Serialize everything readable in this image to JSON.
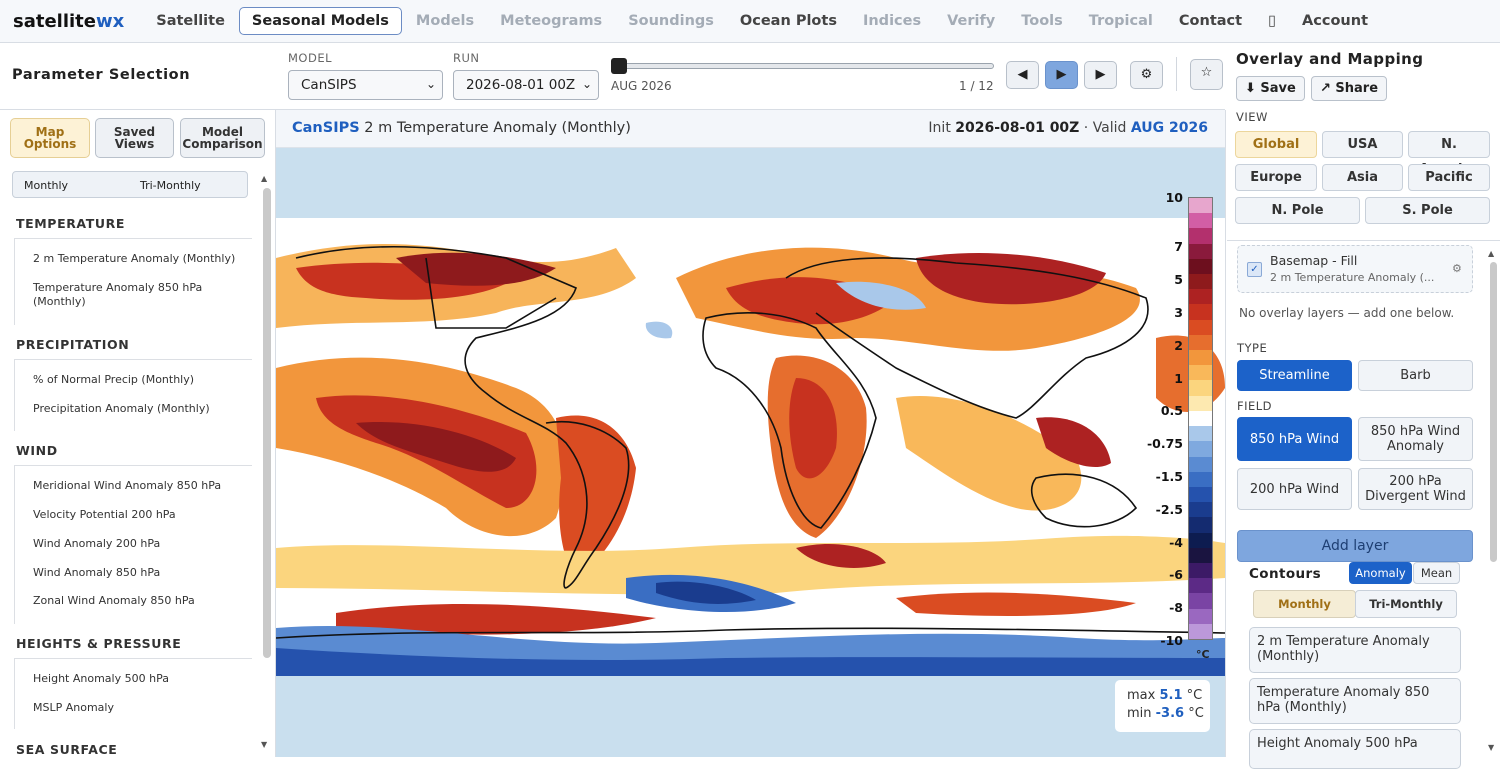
{
  "nav": {
    "brand_main": "satellite",
    "brand_accent": "wx",
    "items": [
      "Satellite",
      "Seasonal Models",
      "Models",
      "Meteograms",
      "Soundings",
      "Ocean Plots",
      "Indices",
      "Verify",
      "Tools",
      "Tropical",
      "Contact",
      "Account"
    ],
    "active": "Seasonal Models",
    "icon_glyph": "▯"
  },
  "toolbar": {
    "panel_title": "Parameter Selection",
    "model_label": "MODEL",
    "model_value": "CanSIPS",
    "run_label": "RUN",
    "run_value": "2026-08-01 00Z",
    "frame_label": "AUG 2026",
    "frame_counter": "1 / 12",
    "prev_glyph": "◀",
    "play_glyph": "▶",
    "next_glyph": "▶",
    "settings_glyph": "⚙",
    "star_glyph": "☆"
  },
  "left": {
    "tabs": [
      "Map Options",
      "Saved Views",
      "Model Comparison"
    ],
    "tab_lines": [
      [
        "Map",
        "Options"
      ],
      [
        "Saved",
        "Views"
      ],
      [
        "Model",
        "Comparison"
      ]
    ],
    "period_options": [
      "Monthly",
      "Tri-Monthly"
    ],
    "categories": [
      {
        "name": "TEMPERATURE",
        "items": [
          "2 m Temperature Anomaly (Monthly)",
          "Temperature Anomaly 850 hPa (Monthly)"
        ]
      },
      {
        "name": "PRECIPITATION",
        "items": [
          "% of Normal Precip (Monthly)",
          "Precipitation Anomaly (Monthly)"
        ]
      },
      {
        "name": "WIND",
        "items": [
          "Meridional Wind Anomaly 850 hPa",
          "Velocity Potential 200 hPa",
          "Wind Anomaly 200 hPa",
          "Wind Anomaly 850 hPa",
          "Zonal Wind Anomaly 850 hPa"
        ]
      },
      {
        "name": "HEIGHTS & PRESSURE",
        "items": [
          "Height Anomaly 500 hPa",
          "MSLP Anomaly"
        ]
      },
      {
        "name": "SEA SURFACE",
        "items": []
      }
    ]
  },
  "map": {
    "model": "CanSIPS",
    "title": "2 m Temperature Anomaly (Monthly)",
    "init_label": "Init",
    "init_value": "2026-08-01 00Z",
    "sep": "·",
    "valid_label": "Valid",
    "valid_value": "AUG 2026",
    "colorbar_labels": [
      "10",
      "7",
      "5",
      "3",
      "2",
      "1",
      "0.5",
      "-0.75",
      "-1.5",
      "-2.5",
      "-4",
      "-6",
      "-8",
      "-10"
    ],
    "colorbar_colors": [
      "#e7a6cd",
      "#d25ea5",
      "#b3306d",
      "#8a1a3c",
      "#6d0f1e",
      "#8e1a1c",
      "#ad2222",
      "#c7321f",
      "#da4c22",
      "#e66e2e",
      "#f2963c",
      "#f9b85a",
      "#fbd57e",
      "#fde9b0",
      "#ffffff",
      "#a9c8ea",
      "#7fa9df",
      "#5a8bd2",
      "#3a6ec3",
      "#2552ad",
      "#1a3c8e",
      "#142b70",
      "#0d1c50",
      "#1a1440",
      "#3c1a66",
      "#5c2a86",
      "#7a44a4",
      "#9a68c0",
      "#bc98da"
    ],
    "unit": "°C",
    "max_label": "max",
    "max_value": "5.1",
    "min_label": "min",
    "min_value": "-3.6",
    "stat_unit": "°C"
  },
  "right": {
    "title": "Overlay and Mapping",
    "save_label": "⬇ Save",
    "share_label": "↗ Share",
    "view_label": "VIEW",
    "views": [
      "Global",
      "USA",
      "N. America",
      "Europe",
      "Asia",
      "Pacific",
      "N. Pole",
      "S. Pole"
    ],
    "active_view": "Global",
    "basemap_title": "Basemap - Fill",
    "basemap_sub": "2 m Temperature Anomaly (...",
    "check_glyph": "✓",
    "gear_glyph": "⚙",
    "no_overlay": "No overlay layers — add one below.",
    "type_label": "TYPE",
    "types": [
      "Streamline",
      "Barb"
    ],
    "field_label": "FIELD",
    "fields": [
      "850 hPa Wind",
      "850 hPa Wind Anomaly",
      "200 hPa Wind",
      "200 hPa Divergent Wind"
    ],
    "add_layer": "Add layer",
    "contours_label": "Contours",
    "contour_modes": [
      "Anomaly",
      "Mean"
    ],
    "contour_periods": [
      "Monthly",
      "Tri-Monthly"
    ],
    "contour_items": [
      "2 m Temperature Anomaly (Monthly)",
      "Temperature Anomaly 850 hPa (Monthly)",
      "Height Anomaly 500 hPa"
    ]
  }
}
